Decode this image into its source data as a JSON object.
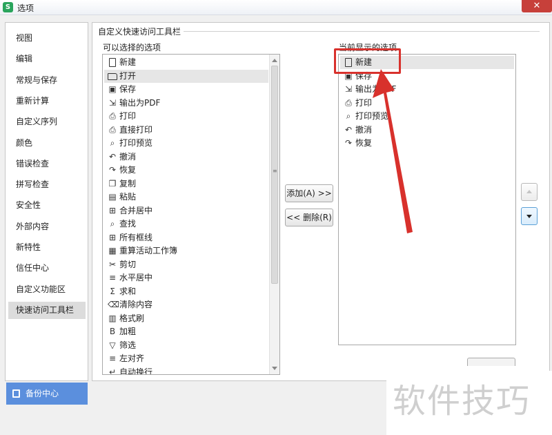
{
  "window": {
    "title": "选项",
    "app_icon_letter": "S",
    "close_glyph": "✕"
  },
  "sidebar": {
    "items": [
      {
        "label": "视图",
        "selected": false
      },
      {
        "label": "编辑",
        "selected": false
      },
      {
        "label": "常规与保存",
        "selected": false
      },
      {
        "label": "重新计算",
        "selected": false
      },
      {
        "label": "自定义序列",
        "selected": false
      },
      {
        "label": "颜色",
        "selected": false
      },
      {
        "label": "错误检查",
        "selected": false
      },
      {
        "label": "拼写检查",
        "selected": false
      },
      {
        "label": "安全性",
        "selected": false
      },
      {
        "label": "外部内容",
        "selected": false
      },
      {
        "label": "新特性",
        "selected": false
      },
      {
        "label": "信任中心",
        "selected": false
      },
      {
        "label": "自定义功能区",
        "selected": false
      },
      {
        "label": "快速访问工具栏",
        "selected": true
      }
    ],
    "backup_label": "备份中心"
  },
  "main": {
    "section_title": "自定义快速访问工具栏",
    "available_label": "可以选择的选项",
    "current_label": "当前显示的选项",
    "available_items": [
      {
        "label": "新建",
        "icon": "new-doc-icon",
        "glyph": ""
      },
      {
        "label": "打开",
        "icon": "open-folder-icon",
        "glyph": ""
      },
      {
        "label": "保存",
        "icon": "save-icon",
        "glyph": "▣"
      },
      {
        "label": "输出为PDF",
        "icon": "export-pdf-icon",
        "glyph": "⇲"
      },
      {
        "label": "打印",
        "icon": "print-icon",
        "glyph": "⎙"
      },
      {
        "label": "直接打印",
        "icon": "direct-print-icon",
        "glyph": "⎙"
      },
      {
        "label": "打印预览",
        "icon": "print-preview-icon",
        "glyph": "⌕"
      },
      {
        "label": "撤消",
        "icon": "undo-icon",
        "glyph": "↶"
      },
      {
        "label": "恢复",
        "icon": "redo-icon",
        "glyph": "↷"
      },
      {
        "label": "复制",
        "icon": "copy-icon",
        "glyph": "❐"
      },
      {
        "label": "粘贴",
        "icon": "paste-icon",
        "glyph": "▤"
      },
      {
        "label": "合并居中",
        "icon": "merge-center-icon",
        "glyph": "⊞"
      },
      {
        "label": "查找",
        "icon": "find-icon",
        "glyph": "⌕"
      },
      {
        "label": "所有框线",
        "icon": "all-borders-icon",
        "glyph": "⊞"
      },
      {
        "label": "重算活动工作簿",
        "icon": "recalc-workbook-icon",
        "glyph": "▦"
      },
      {
        "label": "剪切",
        "icon": "cut-icon",
        "glyph": "✂"
      },
      {
        "label": "水平居中",
        "icon": "align-center-icon",
        "glyph": "≡"
      },
      {
        "label": "求和",
        "icon": "sum-icon",
        "glyph": "Σ"
      },
      {
        "label": "清除内容",
        "icon": "clear-content-icon",
        "glyph": "⌫"
      },
      {
        "label": "格式刷",
        "icon": "format-painter-icon",
        "glyph": "▥"
      },
      {
        "label": "加粗",
        "icon": "bold-icon",
        "glyph": "B"
      },
      {
        "label": "筛选",
        "icon": "filter-icon",
        "glyph": "▽"
      },
      {
        "label": "左对齐",
        "icon": "align-left-icon",
        "glyph": "≡"
      },
      {
        "label": "自动换行",
        "icon": "wrap-text-icon",
        "glyph": "↵"
      }
    ],
    "current_items": [
      {
        "label": "新建",
        "icon": "new-doc-icon",
        "glyph": ""
      },
      {
        "label": "保存",
        "icon": "save-icon",
        "glyph": "▣"
      },
      {
        "label": "输出为PDF",
        "icon": "export-pdf-icon",
        "glyph": "⇲"
      },
      {
        "label": "打印",
        "icon": "print-icon",
        "glyph": "⎙"
      },
      {
        "label": "打印预览",
        "icon": "print-preview-icon",
        "glyph": "⌕"
      },
      {
        "label": "撤消",
        "icon": "undo-icon",
        "glyph": "↶"
      },
      {
        "label": "恢复",
        "icon": "redo-icon",
        "glyph": "↷"
      }
    ],
    "add_button": "添加(A) >>",
    "remove_button": "<< 删除(R)",
    "grip_glyph": "≡"
  },
  "watermark": "软件技巧",
  "colors": {
    "highlight": "#d8312c",
    "accent": "#5b8fdd",
    "selected_nav": "#dcdcdc"
  }
}
